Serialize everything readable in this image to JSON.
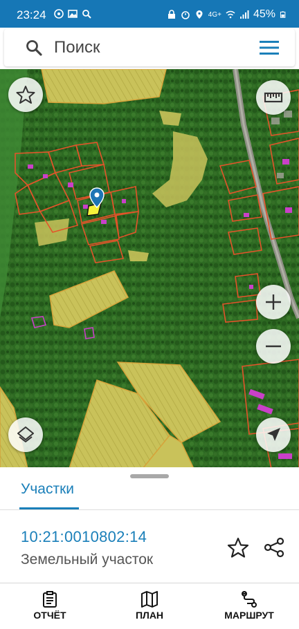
{
  "status_bar": {
    "time": "23:24",
    "network": "4G+",
    "battery": "45%",
    "left_icons": [
      "whatsapp-icon",
      "gallery-icon",
      "search-icon"
    ],
    "right_icons": [
      "lock-icon",
      "alarm-icon",
      "location-icon",
      "wifi-icon",
      "signal-icon",
      "battery-icon"
    ]
  },
  "search": {
    "placeholder": "Поиск",
    "icon": "search-icon",
    "menu_icon": "hamburger-menu-icon"
  },
  "map": {
    "buttons": {
      "favorite": "star-icon",
      "ruler": "ruler-icon",
      "zoom_in": "plus-icon",
      "zoom_out": "minus-icon",
      "layers": "layers-icon",
      "locate": "navigation-arrow-icon"
    },
    "marker": "location-pin-icon",
    "colors": {
      "forest": "#2f6e24",
      "field": "#c9c25a",
      "boundary": "#e4532a",
      "building": "#c940c8"
    }
  },
  "sheet": {
    "tab_label": "Участки",
    "parcel_id": "10:21:0010802:14",
    "parcel_type": "Земельный участок",
    "accent_color": "#1a7fb9"
  },
  "bottom_nav": [
    {
      "label": "ОТЧЁТ",
      "icon": "report-clipboard-icon"
    },
    {
      "label": "ПЛАН",
      "icon": "map-plan-icon"
    },
    {
      "label": "МАРШРУТ",
      "icon": "route-icon"
    }
  ]
}
